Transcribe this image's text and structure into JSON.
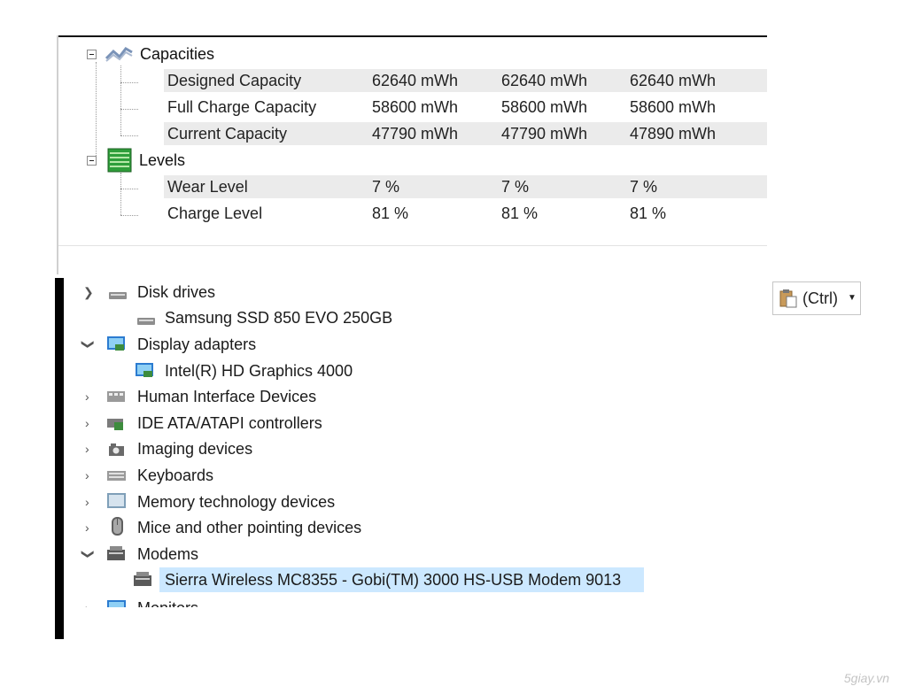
{
  "sensors": {
    "capacities": {
      "label": "Capacities",
      "rows": [
        {
          "name": "Designed Capacity",
          "v1": "62640 mWh",
          "v2": "62640 mWh",
          "v3": "62640 mWh"
        },
        {
          "name": "Full Charge Capacity",
          "v1": "58600 mWh",
          "v2": "58600 mWh",
          "v3": "58600 mWh"
        },
        {
          "name": "Current Capacity",
          "v1": "47790 mWh",
          "v2": "47790 mWh",
          "v3": "47890 mWh"
        }
      ]
    },
    "levels": {
      "label": "Levels",
      "rows": [
        {
          "name": "Wear Level",
          "v1": "7 %",
          "v2": "7 %",
          "v3": "7 %"
        },
        {
          "name": "Charge Level",
          "v1": "81 %",
          "v2": "81 %",
          "v3": "81 %"
        }
      ]
    }
  },
  "device_manager": {
    "items": [
      {
        "label": "Disk drives",
        "expanded": true,
        "icon": "disk-drive-icon"
      },
      {
        "label": "Samsung SSD 850 EVO 250GB",
        "child": true,
        "icon": "disk-drive-icon"
      },
      {
        "label": "Display adapters",
        "expanded": true,
        "icon": "display-adapter-icon"
      },
      {
        "label": "Intel(R) HD Graphics 4000",
        "child": true,
        "icon": "display-adapter-icon"
      },
      {
        "label": "Human Interface Devices",
        "expanded": false,
        "icon": "hid-icon"
      },
      {
        "label": "IDE ATA/ATAPI controllers",
        "expanded": false,
        "icon": "ide-controller-icon"
      },
      {
        "label": "Imaging devices",
        "expanded": false,
        "icon": "camera-icon"
      },
      {
        "label": "Keyboards",
        "expanded": false,
        "icon": "keyboard-icon"
      },
      {
        "label": "Memory technology devices",
        "expanded": false,
        "icon": "memory-icon"
      },
      {
        "label": "Mice and other pointing devices",
        "expanded": false,
        "icon": "mouse-icon"
      },
      {
        "label": "Modems",
        "expanded": true,
        "icon": "modem-icon"
      },
      {
        "label": "Sierra Wireless MC8355 - Gobi(TM) 3000 HS-USB Modem 9013",
        "child": true,
        "selected": true,
        "icon": "modem-icon"
      },
      {
        "label": "Monitors",
        "expanded": false,
        "icon": "monitor-icon"
      }
    ]
  },
  "paste_options": {
    "label": "(Ctrl)",
    "icon": "clipboard-icon"
  },
  "watermark": "5giay.vn",
  "colors": {
    "selection": "#cce8ff",
    "row_band": "#ebebeb",
    "level_icon": "#2e9e3a"
  }
}
